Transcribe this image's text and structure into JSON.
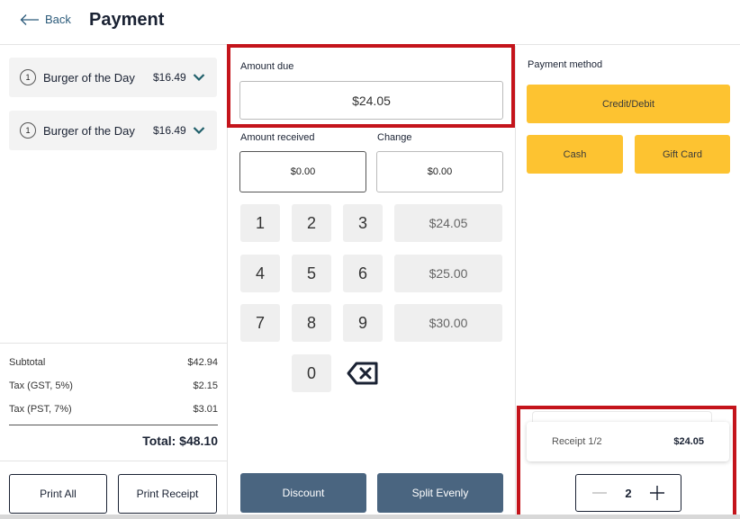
{
  "header": {
    "back_label": "Back",
    "title": "Payment"
  },
  "order": {
    "items": [
      {
        "qty": "1",
        "name": "Burger of the Day",
        "price": "$16.49"
      },
      {
        "qty": "1",
        "name": "Burger of the Day",
        "price": "$16.49"
      }
    ]
  },
  "totals": {
    "subtotal_label": "Subtotal",
    "subtotal": "$42.94",
    "gst_label": "Tax (GST, 5%)",
    "gst": "$2.15",
    "pst_label": "Tax (PST, 7%)",
    "pst": "$3.01",
    "total": "Total: $48.10"
  },
  "left_actions": {
    "print_all": "Print All",
    "print_receipt": "Print Receipt"
  },
  "amount_due": {
    "label": "Amount due",
    "value": "$24.05"
  },
  "amount_received": {
    "label": "Amount received",
    "value": "$0.00"
  },
  "change": {
    "label": "Change",
    "value": "$0.00"
  },
  "keypad": {
    "keys": [
      "1",
      "2",
      "3",
      "4",
      "5",
      "6",
      "7",
      "8",
      "9",
      "0"
    ],
    "quick_amounts": [
      "$24.05",
      "$25.00",
      "$30.00"
    ]
  },
  "mid_actions": {
    "discount": "Discount",
    "split_evenly": "Split Evenly"
  },
  "payment_method": {
    "label": "Payment method",
    "credit_debit": "Credit/Debit",
    "cash": "Cash",
    "gift_card": "Gift Card"
  },
  "receipt": {
    "name": "Receipt 1/2",
    "amount": "$24.05"
  },
  "split_stepper": {
    "value": "2"
  },
  "colors": {
    "accent_yellow": "#fdc331",
    "slate": "#4a6580",
    "highlight_red": "#c4141b",
    "text_dark": "#1a2233"
  }
}
